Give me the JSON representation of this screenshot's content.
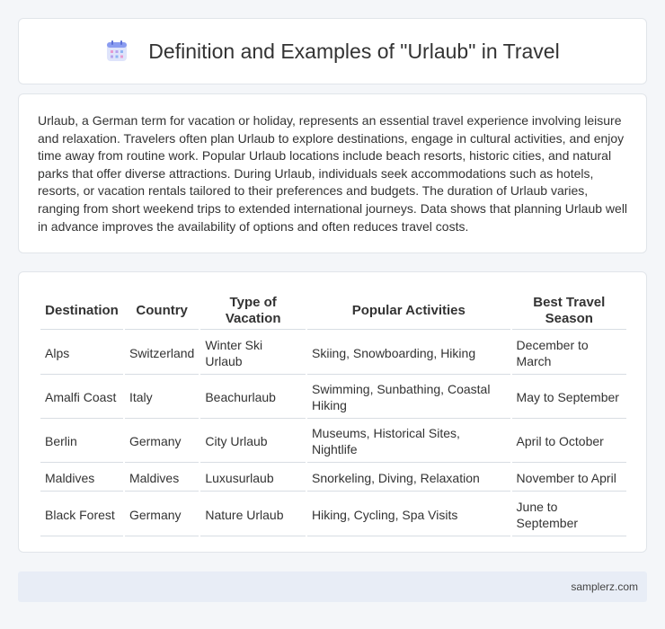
{
  "header": {
    "icon": "calendar-icon",
    "title": "Definition and Examples of \"Urlaub\" in Travel"
  },
  "intro": {
    "text": "Urlaub, a German term for vacation or holiday, represents an essential travel experience involving leisure and relaxation. Travelers often plan Urlaub to explore destinations, engage in cultural activities, and enjoy time away from routine work. Popular Urlaub locations include beach resorts, historic cities, and natural parks that offer diverse attractions. During Urlaub, individuals seek accommodations such as hotels, resorts, or vacation rentals tailored to their preferences and budgets. The duration of Urlaub varies, ranging from short weekend trips to extended international journeys. Data shows that planning Urlaub well in advance improves the availability of options and often reduces travel costs."
  },
  "table": {
    "headers": [
      "Destination",
      "Country",
      "Type of Vacation",
      "Popular Activities",
      "Best Travel Season"
    ],
    "rows": [
      [
        "Alps",
        "Switzerland",
        "Winter Ski Urlaub",
        "Skiing, Snowboarding, Hiking",
        "December to March"
      ],
      [
        "Amalfi Coast",
        "Italy",
        "Beachurlaub",
        "Swimming, Sunbathing, Coastal Hiking",
        "May to September"
      ],
      [
        "Berlin",
        "Germany",
        "City Urlaub",
        "Museums, Historical Sites, Nightlife",
        "April to October"
      ],
      [
        "Maldives",
        "Maldives",
        "Luxusurlaub",
        "Snorkeling, Diving, Relaxation",
        "November to April"
      ],
      [
        "Black Forest",
        "Germany",
        "Nature Urlaub",
        "Hiking, Cycling, Spa Visits",
        "June to September"
      ]
    ]
  },
  "footer": {
    "site": "samplerz.com"
  },
  "colors": {
    "background": "#f4f6f9",
    "card": "#ffffff",
    "footer": "#e8edf6",
    "icon_accent": "#7b8ee8"
  }
}
